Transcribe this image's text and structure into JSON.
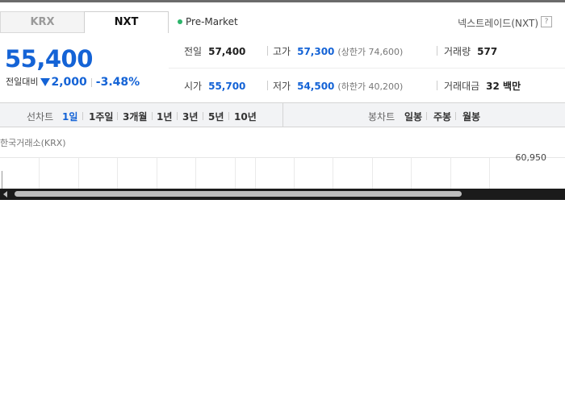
{
  "tabs": [
    {
      "label": "KRX",
      "active": false
    },
    {
      "label": "NXT",
      "active": true
    }
  ],
  "market_status": "Pre-Market",
  "exchange_name": "넥스트레이드(NXT)",
  "help_icon_text": "?",
  "price": {
    "current": "55,400",
    "change_label": "전일대비",
    "change_amount": "2,000",
    "change_rate": "-3.48%",
    "direction": "down",
    "color": "#1463d6"
  },
  "stats": {
    "prev_close": {
      "label": "전일",
      "value": "57,400"
    },
    "high": {
      "label": "고가",
      "value": "57,300",
      "note": "(상한가 74,600)"
    },
    "volume": {
      "label": "거래량",
      "value": "577"
    },
    "open": {
      "label": "시가",
      "value": "55,700"
    },
    "low": {
      "label": "저가",
      "value": "54,500",
      "note": "(하한가 40,200)"
    },
    "trade_amount": {
      "label": "거래대금",
      "value": "32 백만"
    }
  },
  "line_chart": {
    "label": "선차트",
    "periods": [
      {
        "label": "1일",
        "active": true
      },
      {
        "label": "1주일",
        "active": false
      },
      {
        "label": "3개월",
        "active": false
      },
      {
        "label": "1년",
        "active": false
      },
      {
        "label": "3년",
        "active": false
      },
      {
        "label": "5년",
        "active": false
      },
      {
        "label": "10년",
        "active": false
      }
    ]
  },
  "candle_chart": {
    "label": "봉차트",
    "periods": [
      {
        "label": "일봉"
      },
      {
        "label": "주봉"
      },
      {
        "label": "월봉"
      }
    ]
  },
  "chart": {
    "source_label": "한국거래소(KRX)",
    "y_axis_top": "60,950"
  }
}
